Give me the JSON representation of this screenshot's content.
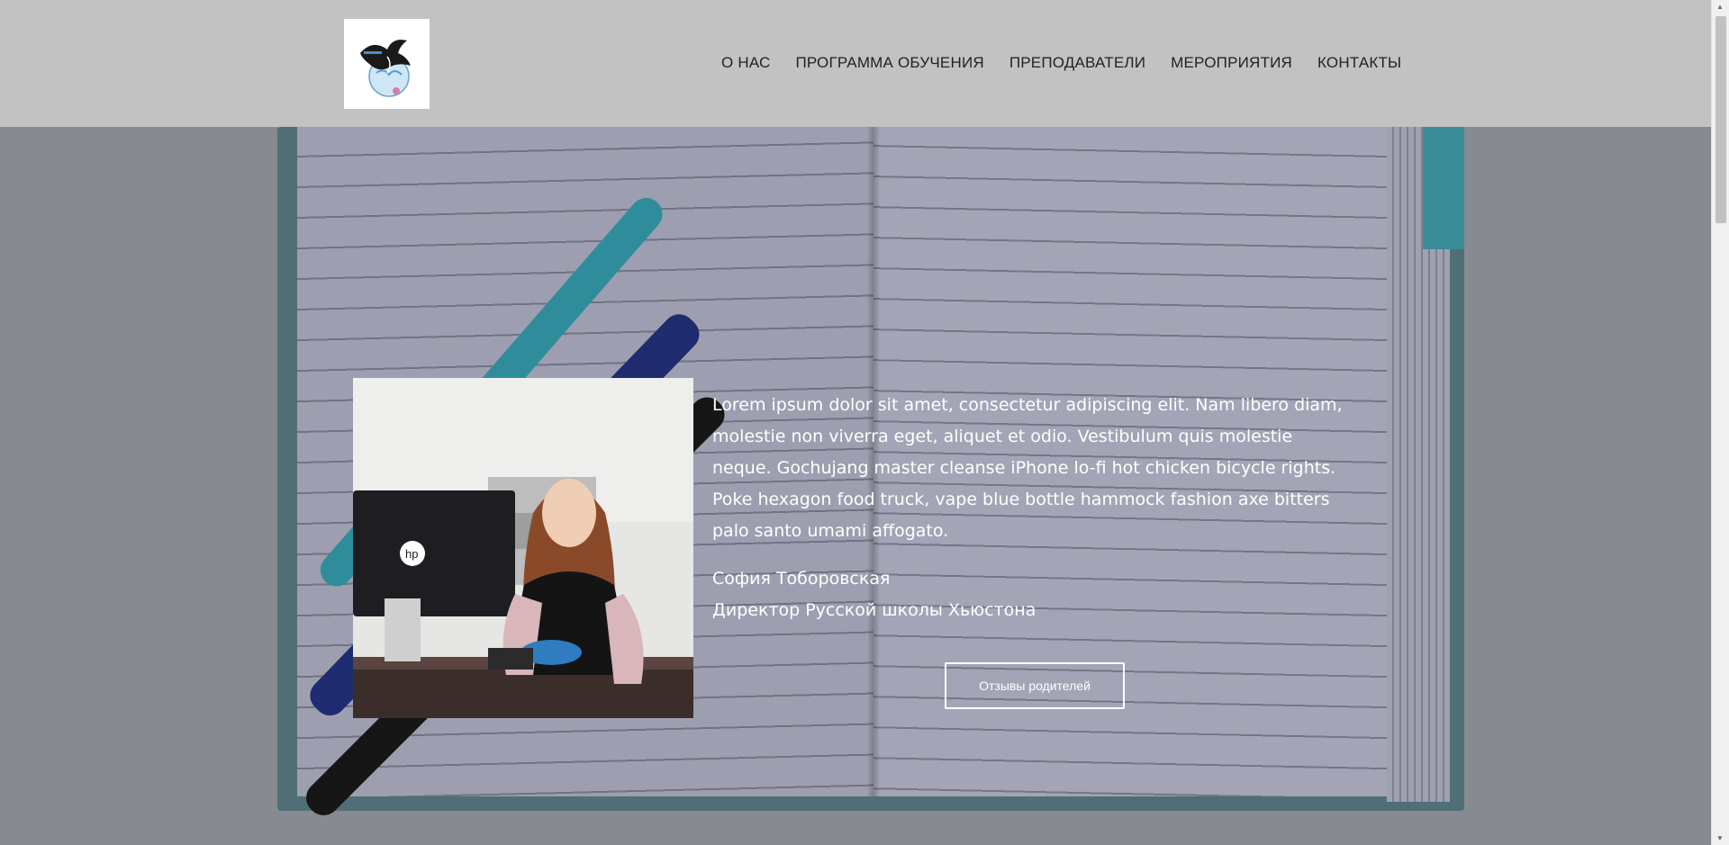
{
  "header": {
    "logo_alt": "Russian School of Houston logo",
    "nav": [
      {
        "label": "О НАС"
      },
      {
        "label": "ПРОГРАММА ОБУЧЕНИЯ"
      },
      {
        "label": "ПРЕПОДАВАТЕЛИ"
      },
      {
        "label": "МЕРОПРИЯТИЯ"
      },
      {
        "label": "КОНТАКТЫ"
      }
    ]
  },
  "hero": {
    "quote": "Lorem ipsum dolor sit amet, consectetur adipiscing elit. Nam libero diam, molestie non viverra eget, aliquet et odio. Vestibulum quis molestie neque. Gochujang master cleanse iPhone lo-fi hot chicken bicycle rights. Poke hexagon food truck, vape blue bottle hammock fashion axe bitters palo santo umami affogato.",
    "author_name": "София Тоборовская",
    "author_title": "Директор Русской школы Хьюстона",
    "reviews_button": "Отзывы родителей"
  },
  "colors": {
    "header_bg": "#c2c2c2",
    "text_on_hero": "#ffffff"
  }
}
